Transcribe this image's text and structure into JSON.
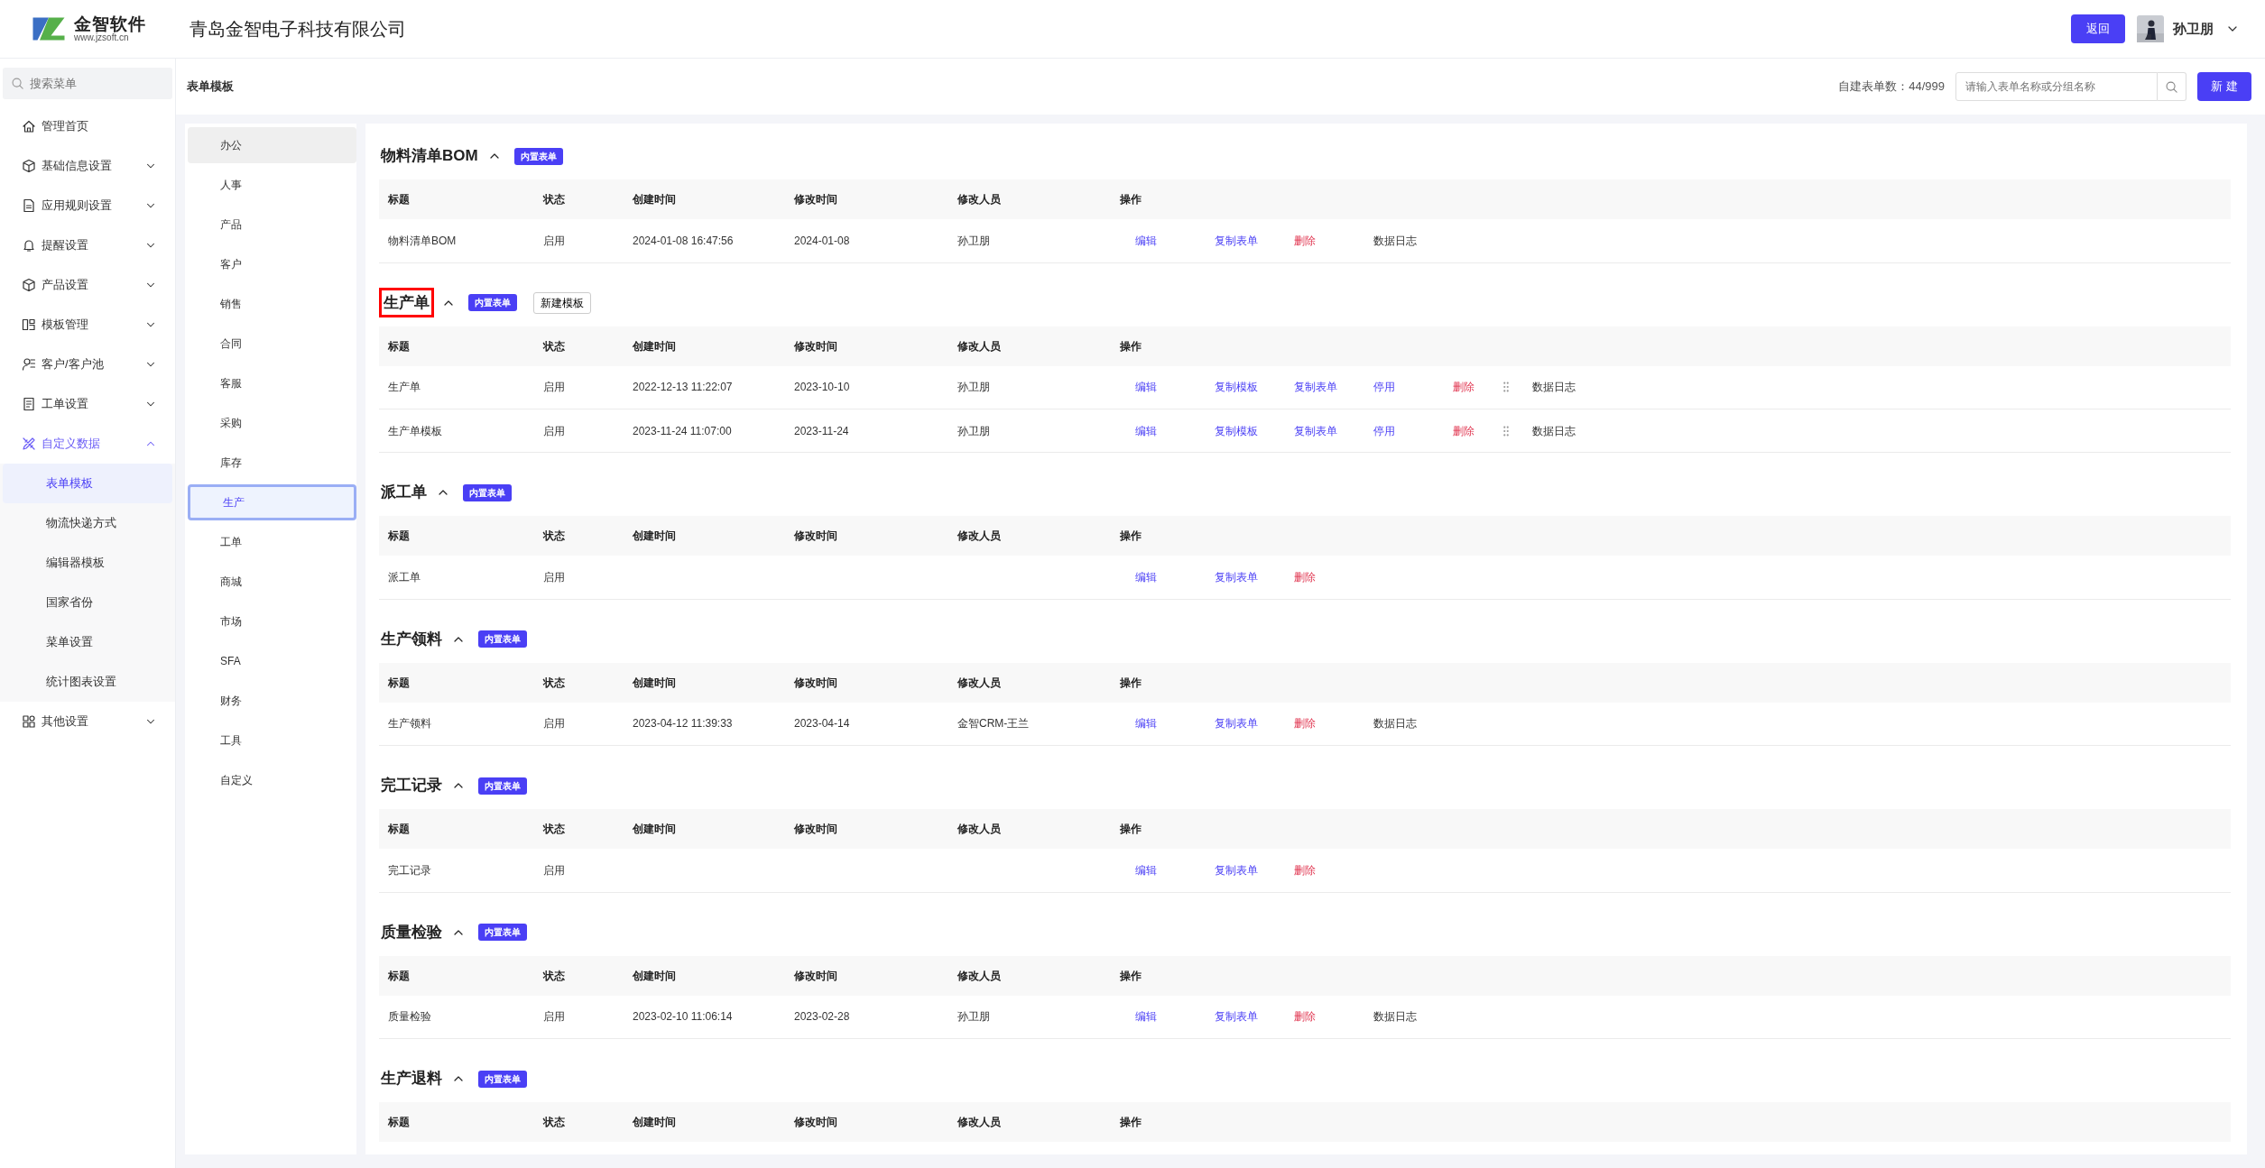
{
  "header": {
    "logo_name": "金智软件",
    "logo_url": "www.jzsoft.cn",
    "company": "青岛金智电子科技有限公司",
    "back_button": "返回",
    "user_name": "孙卫朋"
  },
  "sidebar": {
    "search": {
      "placeholder": "搜索菜单"
    },
    "items": [
      {
        "label": "管理首页",
        "kind": "link",
        "selected": false
      },
      {
        "label": "基础信息设置",
        "kind": "group",
        "selected": false,
        "expanded": false
      },
      {
        "label": "应用规则设置",
        "kind": "group",
        "selected": false,
        "expanded": false
      },
      {
        "label": "提醒设置",
        "kind": "group",
        "selected": false,
        "expanded": false
      },
      {
        "label": "产品设置",
        "kind": "group",
        "selected": false,
        "expanded": false
      },
      {
        "label": "模板管理",
        "kind": "group",
        "selected": false,
        "expanded": false
      },
      {
        "label": "客户/客户池",
        "kind": "group",
        "selected": false,
        "expanded": false
      },
      {
        "label": "工单设置",
        "kind": "group",
        "selected": false,
        "expanded": false
      },
      {
        "label": "自定义数据",
        "kind": "group",
        "selected": true,
        "expanded": true,
        "children": [
          {
            "label": "表单模板",
            "selected": true
          },
          {
            "label": "物流快递方式",
            "selected": false
          },
          {
            "label": "编辑器模板",
            "selected": false
          },
          {
            "label": "国家省份",
            "selected": false
          },
          {
            "label": "菜单设置",
            "selected": false
          },
          {
            "label": "统计图表设置",
            "selected": false
          }
        ]
      },
      {
        "label": "其他设置",
        "kind": "group",
        "selected": false,
        "expanded": false
      }
    ]
  },
  "page_title": "表单模板",
  "toolbar": {
    "count_label": "自建表单数：44/999",
    "search": {
      "placeholder": "请输入表单名称或分组名称"
    },
    "new_button": "新 建"
  },
  "categories": [
    {
      "label": "办公",
      "selected": false,
      "hovered": true
    },
    {
      "label": "人事",
      "selected": false,
      "hovered": false
    },
    {
      "label": "产品",
      "selected": false,
      "hovered": false
    },
    {
      "label": "客户",
      "selected": false,
      "hovered": false
    },
    {
      "label": "销售",
      "selected": false,
      "hovered": false
    },
    {
      "label": "合同",
      "selected": false,
      "hovered": false
    },
    {
      "label": "客服",
      "selected": false,
      "hovered": false
    },
    {
      "label": "采购",
      "selected": false,
      "hovered": false
    },
    {
      "label": "库存",
      "selected": false,
      "hovered": false
    },
    {
      "label": "生产",
      "selected": true,
      "hovered": false
    },
    {
      "label": "工单",
      "selected": false,
      "hovered": false
    },
    {
      "label": "商城",
      "selected": false,
      "hovered": false
    },
    {
      "label": "市场",
      "selected": false,
      "hovered": false
    },
    {
      "label": "SFA",
      "selected": false,
      "hovered": false
    },
    {
      "label": "财务",
      "selected": false,
      "hovered": false
    },
    {
      "label": "工具",
      "selected": false,
      "hovered": false
    },
    {
      "label": "自定义",
      "selected": false,
      "hovered": false
    }
  ],
  "sections": [
    {
      "title": "物料清单BOM",
      "expanded": true,
      "highlighted": false,
      "badge": "内置表单",
      "columns": [
        "标题",
        "状态",
        "创建时间",
        "修改时间",
        "修改人员",
        "操作"
      ],
      "rows": [
        {
          "cells": [
            "物料清单BOM",
            "启用",
            "2024-01-08 16:47:56",
            "2024-01-08",
            "孙卫朋"
          ],
          "handle": false,
          "actions": [
            {
              "label": "编辑",
              "kind": "link"
            },
            {
              "label": "复制表单",
              "kind": "link"
            },
            {
              "label": "删除",
              "kind": "danger"
            },
            {
              "label": "数据日志",
              "kind": "plain"
            }
          ]
        }
      ]
    },
    {
      "title": "生产单",
      "expanded": true,
      "highlighted": true,
      "badge": "内置表单",
      "extra_button": "新建模板",
      "columns": [
        "标题",
        "状态",
        "创建时间",
        "修改时间",
        "修改人员",
        "操作"
      ],
      "rows": [
        {
          "cells": [
            "生产单",
            "启用",
            "2022-12-13 11:22:07",
            "2023-10-10",
            "孙卫朋"
          ],
          "handle": true,
          "actions": [
            {
              "label": "编辑",
              "kind": "link"
            },
            {
              "label": "复制模板",
              "kind": "link"
            },
            {
              "label": "复制表单",
              "kind": "link"
            },
            {
              "label": "停用",
              "kind": "link"
            },
            {
              "label": "删除",
              "kind": "danger"
            },
            {
              "label": "数据日志",
              "kind": "plain"
            }
          ]
        },
        {
          "cells": [
            "生产单模板",
            "启用",
            "2023-11-24 11:07:00",
            "2023-11-24",
            "孙卫朋"
          ],
          "handle": true,
          "actions": [
            {
              "label": "编辑",
              "kind": "link"
            },
            {
              "label": "复制模板",
              "kind": "link"
            },
            {
              "label": "复制表单",
              "kind": "link"
            },
            {
              "label": "停用",
              "kind": "link"
            },
            {
              "label": "删除",
              "kind": "danger"
            },
            {
              "label": "数据日志",
              "kind": "plain"
            }
          ]
        }
      ]
    },
    {
      "title": "派工单",
      "expanded": true,
      "highlighted": false,
      "badge": "内置表单",
      "columns": [
        "标题",
        "状态",
        "创建时间",
        "修改时间",
        "修改人员",
        "操作"
      ],
      "rows": [
        {
          "cells": [
            "派工单",
            "启用",
            "",
            "",
            ""
          ],
          "handle": false,
          "actions": [
            {
              "label": "编辑",
              "kind": "link"
            },
            {
              "label": "复制表单",
              "kind": "link"
            },
            {
              "label": "删除",
              "kind": "danger"
            }
          ]
        }
      ]
    },
    {
      "title": "生产领料",
      "expanded": true,
      "highlighted": false,
      "badge": "内置表单",
      "columns": [
        "标题",
        "状态",
        "创建时间",
        "修改时间",
        "修改人员",
        "操作"
      ],
      "rows": [
        {
          "cells": [
            "生产领料",
            "启用",
            "2023-04-12 11:39:33",
            "2023-04-14",
            "金智CRM-王兰"
          ],
          "handle": false,
          "actions": [
            {
              "label": "编辑",
              "kind": "link"
            },
            {
              "label": "复制表单",
              "kind": "link"
            },
            {
              "label": "删除",
              "kind": "danger"
            },
            {
              "label": "数据日志",
              "kind": "plain"
            }
          ]
        }
      ]
    },
    {
      "title": "完工记录",
      "expanded": true,
      "highlighted": false,
      "badge": "内置表单",
      "columns": [
        "标题",
        "状态",
        "创建时间",
        "修改时间",
        "修改人员",
        "操作"
      ],
      "rows": [
        {
          "cells": [
            "完工记录",
            "启用",
            "",
            "",
            ""
          ],
          "handle": false,
          "actions": [
            {
              "label": "编辑",
              "kind": "link"
            },
            {
              "label": "复制表单",
              "kind": "link"
            },
            {
              "label": "删除",
              "kind": "danger"
            }
          ]
        }
      ]
    },
    {
      "title": "质量检验",
      "expanded": true,
      "highlighted": false,
      "badge": "内置表单",
      "columns": [
        "标题",
        "状态",
        "创建时间",
        "修改时间",
        "修改人员",
        "操作"
      ],
      "rows": [
        {
          "cells": [
            "质量检验",
            "启用",
            "2023-02-10 11:06:14",
            "2023-02-28",
            "孙卫朋"
          ],
          "handle": false,
          "actions": [
            {
              "label": "编辑",
              "kind": "link"
            },
            {
              "label": "复制表单",
              "kind": "link"
            },
            {
              "label": "删除",
              "kind": "danger"
            },
            {
              "label": "数据日志",
              "kind": "plain"
            }
          ]
        }
      ]
    },
    {
      "title": "生产退料",
      "expanded": true,
      "highlighted": false,
      "badge": "内置表单",
      "columns": [
        "标题",
        "状态",
        "创建时间",
        "修改时间",
        "修改人员",
        "操作"
      ]
    }
  ]
}
